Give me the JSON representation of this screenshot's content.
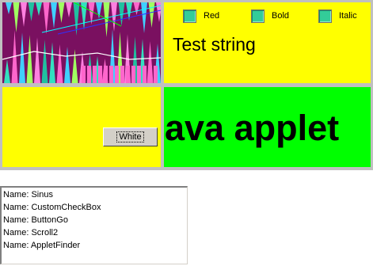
{
  "checkboxes": [
    {
      "label": "Red",
      "checked": false
    },
    {
      "label": "Bold",
      "checked": false
    },
    {
      "label": "Italic",
      "checked": false
    }
  ],
  "test_string": "Test string",
  "button_go": {
    "label": "White"
  },
  "scroller": {
    "text": "ava applet"
  },
  "applet_list": {
    "items": [
      "Name: Sinus",
      "Name: CustomCheckBox",
      "Name: ButtonGo",
      "Name: Scroll2",
      "Name: AppletFinder"
    ]
  },
  "colors": {
    "panel_yellow": "#ffff00",
    "panel_green": "#00ff00",
    "checkbox_fill": "#33cc99",
    "frame_gray": "#c0c0c0"
  }
}
